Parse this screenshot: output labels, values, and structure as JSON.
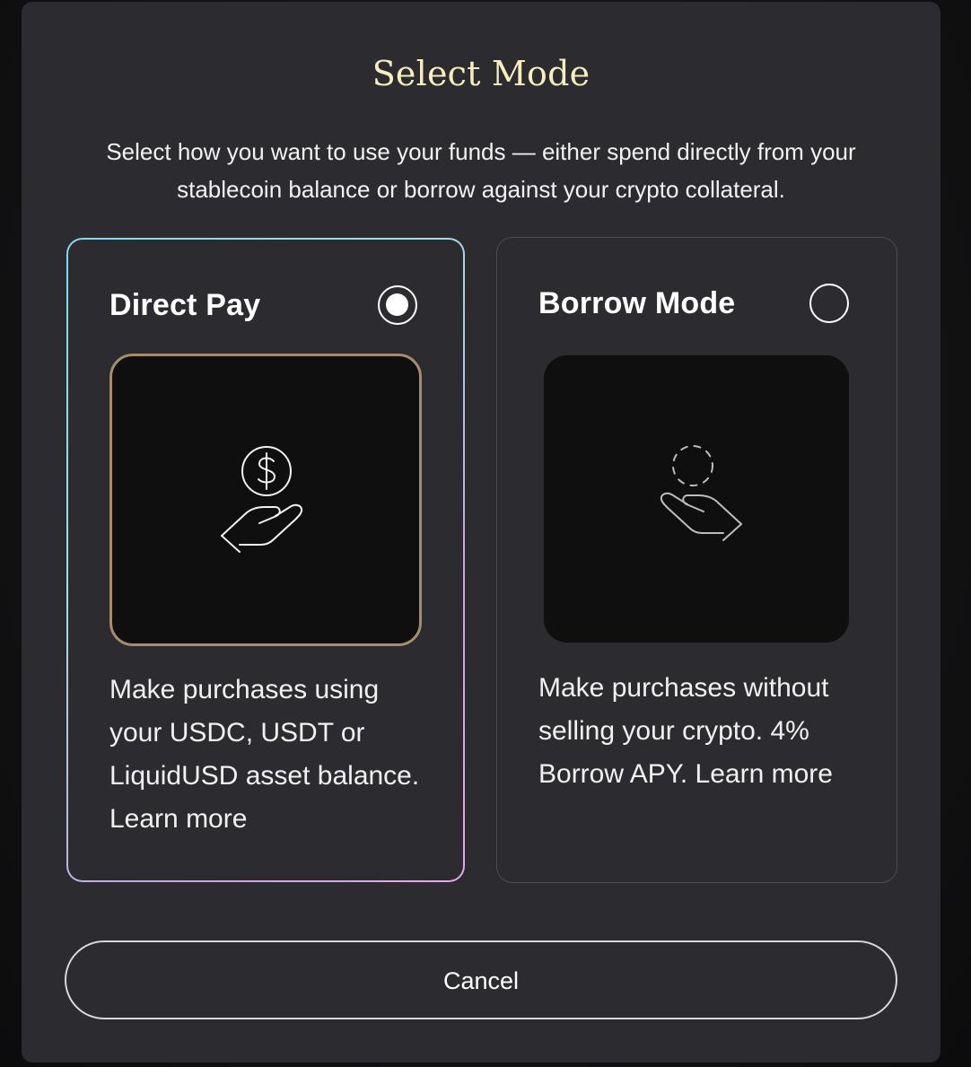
{
  "dialog": {
    "title": "Select Mode",
    "subtitle": "Select how you want to use your funds — either spend directly from your stablecoin balance or borrow against your crypto collateral."
  },
  "options": [
    {
      "title": "Direct Pay",
      "selected": true,
      "icon": "hand-holding-dollar-coin-icon",
      "description": "Make purchases using your USDC, USDT or LiquidUSD asset balance. Learn more"
    },
    {
      "title": "Borrow Mode",
      "selected": false,
      "icon": "hand-holding-dashed-coin-icon",
      "description": "Make purchases without selling your crypto. 4% Borrow APY. Learn more"
    }
  ],
  "actions": {
    "cancel_label": "Cancel"
  },
  "colors": {
    "title": "#f6eebd",
    "modal_background": "#2c2c30",
    "selected_border_gradient": [
      "#7fd8f5",
      "#e6a6f0"
    ],
    "selected_illustration_border": "#a48e6b"
  }
}
